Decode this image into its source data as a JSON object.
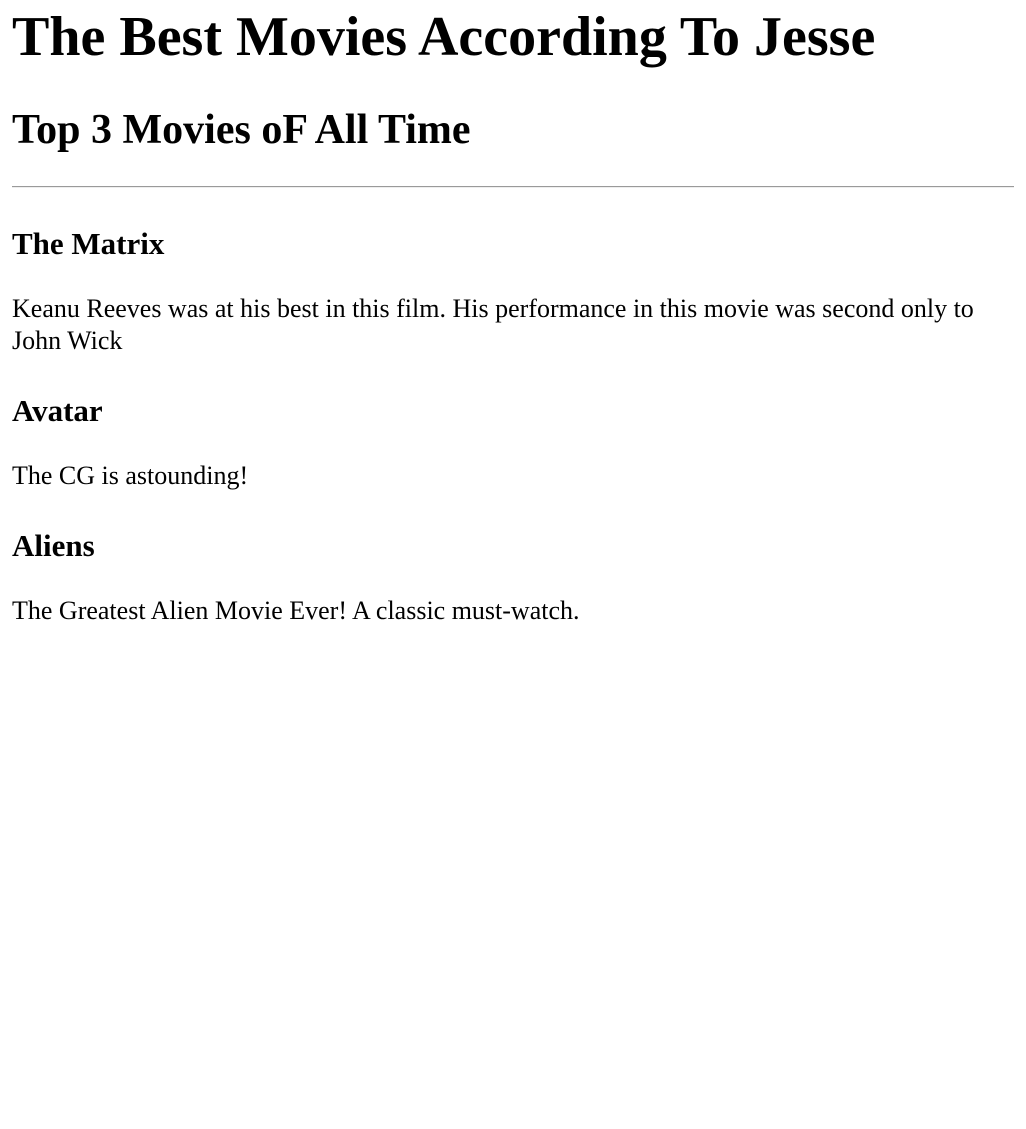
{
  "page": {
    "title": "The Best Movies According To Jesse",
    "subtitle": "Top 3 Movies oF All Time"
  },
  "movies": [
    {
      "name": "The Matrix",
      "description": "Keanu Reeves was at his best in this film. His performance in this movie was second only to John Wick"
    },
    {
      "name": "Avatar",
      "description": "The CG is astounding!"
    },
    {
      "name": "Aliens",
      "description": "The Greatest Alien Movie Ever! A classic must-watch."
    }
  ]
}
